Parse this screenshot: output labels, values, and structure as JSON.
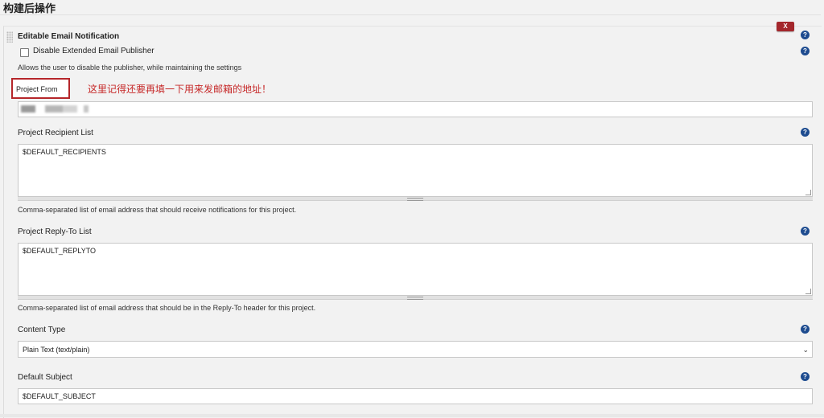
{
  "section": {
    "title": "构建后操作"
  },
  "plugin": {
    "title": "Editable Email Notification",
    "delete_label": "X",
    "help_glyph": "?",
    "disable_publisher": {
      "label": "Disable Extended Email Publisher",
      "checked": false,
      "description": "Allows the user to disable the publisher, while maintaining the settings"
    },
    "project_from": {
      "label": "Project From",
      "annotation": "这里记得还要再填一下用来发邮箱的地址！"
    },
    "recipient_list": {
      "label": "Project Recipient List",
      "value": "$DEFAULT_RECIPIENTS",
      "description": "Comma-separated list of email address that should receive notifications for this project."
    },
    "reply_to_list": {
      "label": "Project Reply-To List",
      "value": "$DEFAULT_REPLYTO",
      "description": "Comma-separated list of email address that should be in the Reply-To header for this project."
    },
    "content_type": {
      "label": "Content Type",
      "selected": "Plain Text (text/plain)"
    },
    "default_subject": {
      "label": "Default Subject",
      "value": "$DEFAULT_SUBJECT"
    }
  },
  "colors": {
    "help_icon": "#1d4b8f",
    "delete_button": "#a4272c",
    "annotation": "#c62828"
  }
}
